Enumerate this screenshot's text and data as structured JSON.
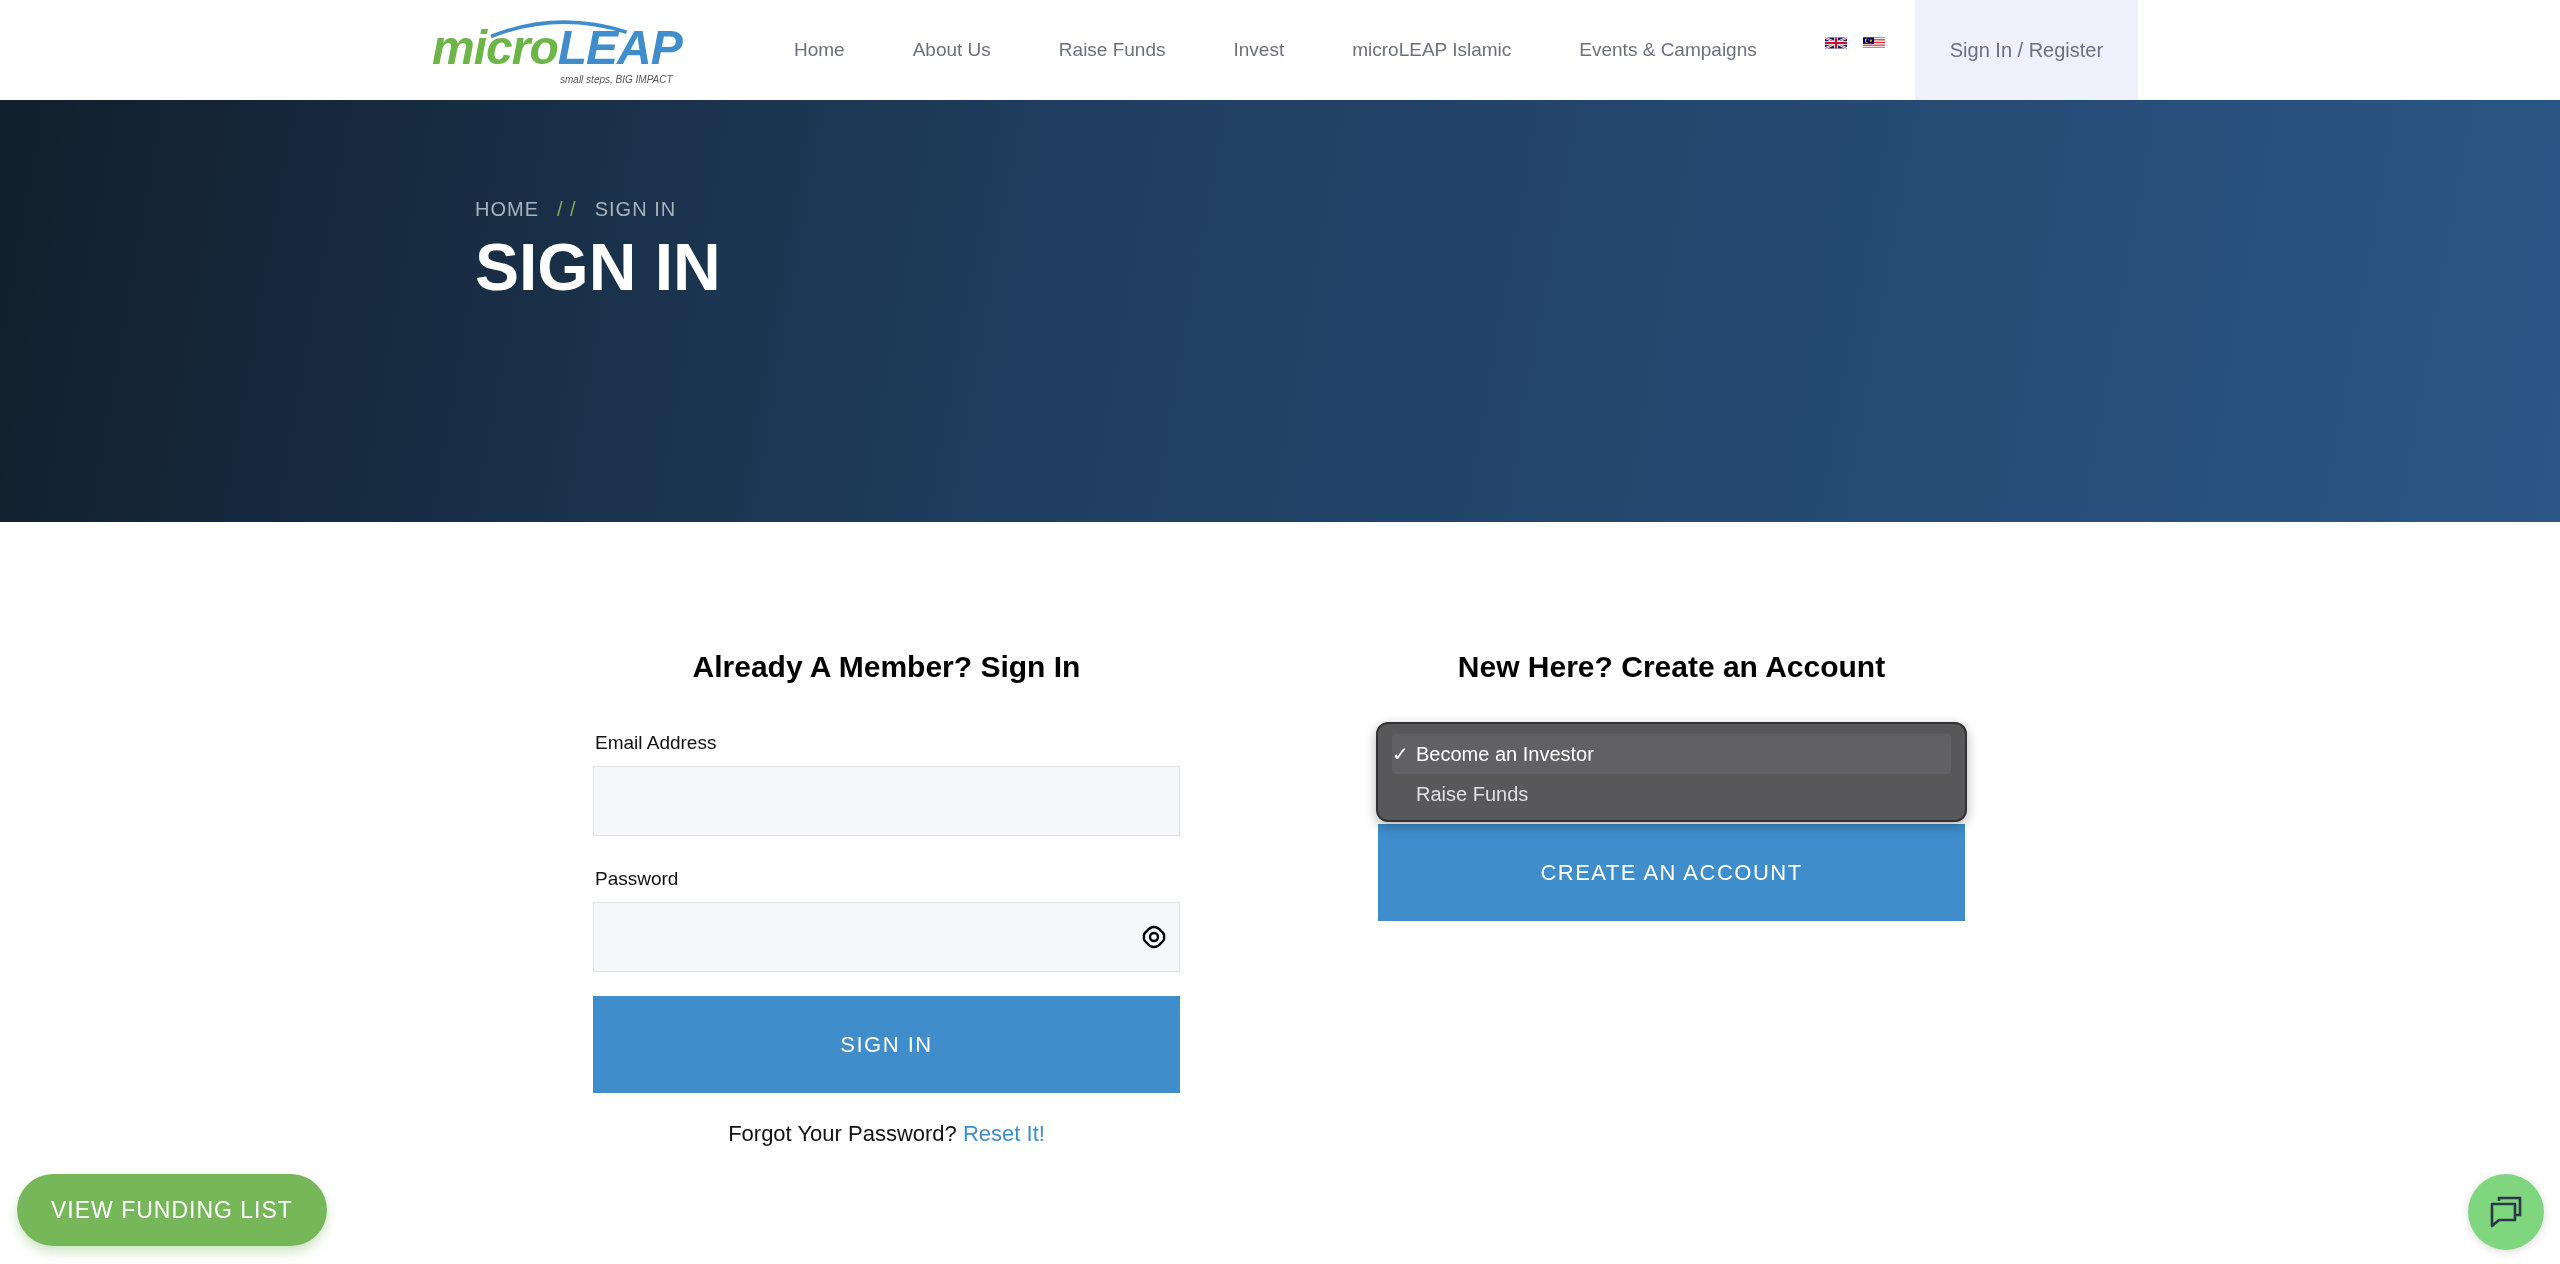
{
  "logo": {
    "brand_start": "micro",
    "brand_end": "LEAP",
    "tagline": "small steps, BIG IMPACT"
  },
  "nav": {
    "items": [
      {
        "label": "Home"
      },
      {
        "label": "About Us"
      },
      {
        "label": "Raise Funds"
      },
      {
        "label": "Invest"
      },
      {
        "label": "microLEAP Islamic"
      },
      {
        "label": "Events & Campaigns"
      }
    ],
    "languages": [
      {
        "kind": "uk"
      },
      {
        "kind": "malaysia"
      }
    ],
    "account_link": "Sign In / Register"
  },
  "hero": {
    "breadcrumb": [
      "HOME",
      "SIGN IN"
    ],
    "separator": "/ /",
    "title": "SIGN IN"
  },
  "sign_in": {
    "heading": "Already A Member? Sign In",
    "email_label": "Email Address",
    "password_label": "Password",
    "button": "SIGN IN",
    "forgot_text": "Forgot Your Password?",
    "reset_link": "Reset It!"
  },
  "register": {
    "heading": "New Here? Create an Account",
    "check_mark": "✓",
    "options": [
      {
        "label": "Become an Investor",
        "selected": true
      },
      {
        "label": "Raise Funds",
        "selected": false
      }
    ],
    "button": "CREATE AN ACCOUNT"
  },
  "funding_button": "VIEW FUNDING LIST"
}
